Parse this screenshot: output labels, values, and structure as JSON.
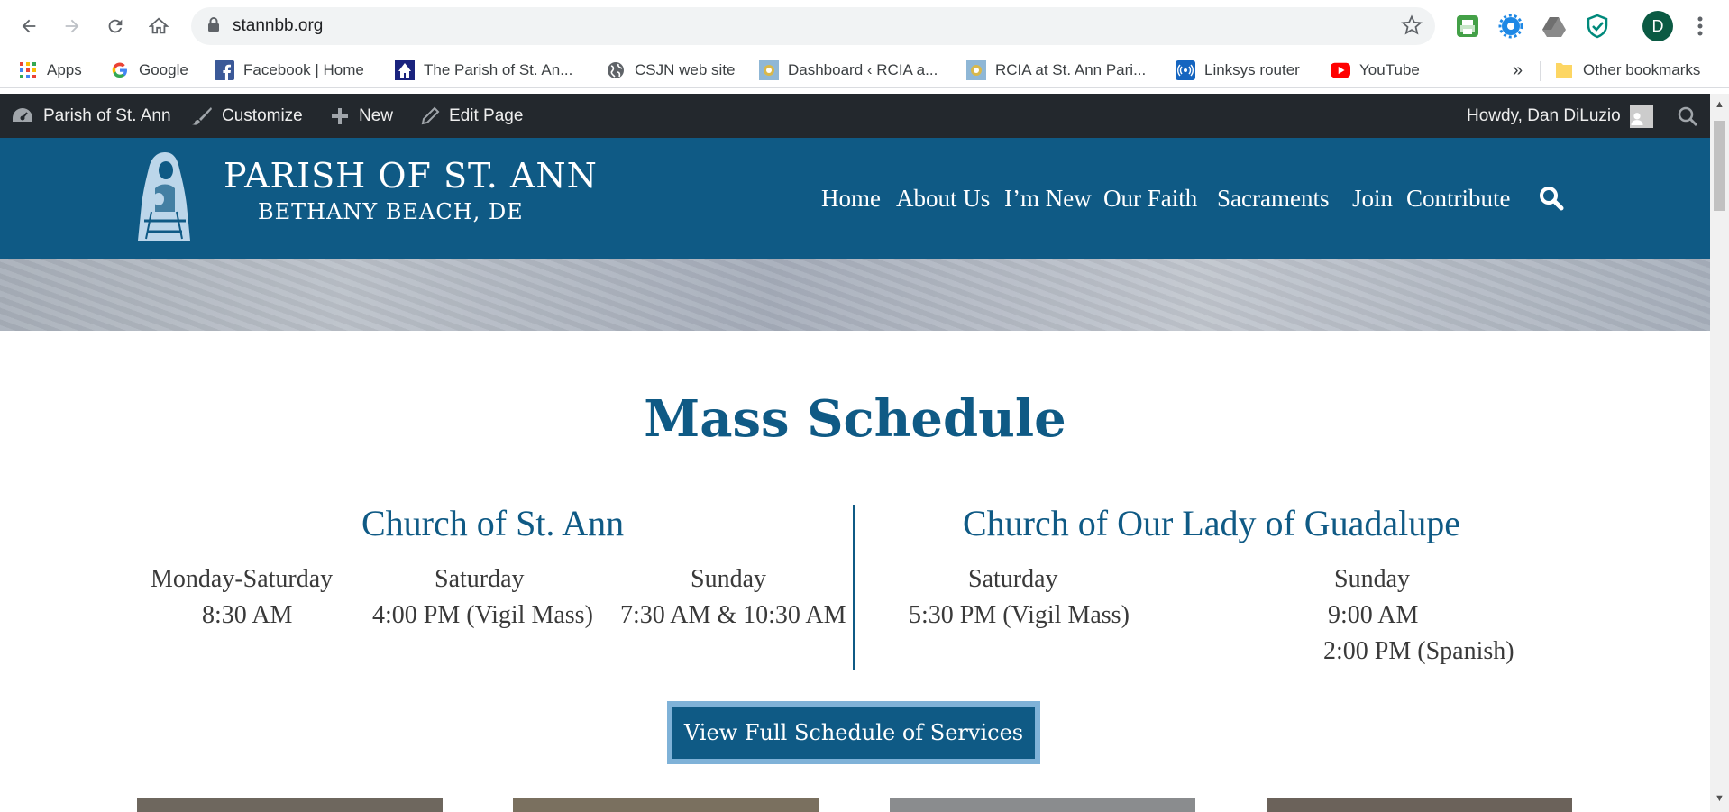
{
  "browser": {
    "url": "stannbb.org",
    "profile_initial": "D"
  },
  "bookmarks": [
    {
      "label": "Apps",
      "icon": "apps-grid-icon"
    },
    {
      "label": "Google",
      "icon": "google-icon"
    },
    {
      "label": "Facebook | Home",
      "icon": "facebook-icon"
    },
    {
      "label": "The Parish of St. An...",
      "icon": "parish-favicon"
    },
    {
      "label": "CSJN web site",
      "icon": "globe-icon"
    },
    {
      "label": "Dashboard ‹ RCIA a...",
      "icon": "rcia-favicon"
    },
    {
      "label": "RCIA at St. Ann Pari...",
      "icon": "rcia-favicon"
    },
    {
      "label": "Linksys router",
      "icon": "linksys-icon"
    },
    {
      "label": "YouTube",
      "icon": "youtube-icon"
    }
  ],
  "bookmarks_overflow": "»",
  "other_bookmarks": "Other bookmarks",
  "admin_bar": {
    "site_name": "Parish of St. Ann",
    "customize": "Customize",
    "new": "New",
    "edit_page": "Edit Page",
    "howdy": "Howdy, Dan DiLuzio"
  },
  "site": {
    "title": "PARISH OF ST. ANN",
    "subtitle": "BETHANY BEACH, DE",
    "nav": [
      "Home",
      "About Us",
      "I’m New",
      "Our Faith",
      "Sacraments",
      "Join",
      "Contribute"
    ]
  },
  "page": {
    "title": "Mass Schedule",
    "churches": [
      {
        "name": "Church of St. Ann",
        "columns": [
          {
            "day": "Monday-Saturday",
            "times": [
              "8:30 AM"
            ]
          },
          {
            "day": "Saturday",
            "times": [
              "4:00 PM (Vigil Mass)"
            ]
          },
          {
            "day": "Sunday",
            "times": [
              "7:30 AM & 10:30 AM"
            ]
          }
        ]
      },
      {
        "name": "Church of Our Lady of Guadalupe",
        "columns": [
          {
            "day": "Saturday",
            "times": [
              "5:30 PM (Vigil Mass)"
            ]
          },
          {
            "day": "Sunday",
            "times": [
              "9:00 AM",
              "2:00 PM (Spanish)"
            ]
          }
        ]
      }
    ],
    "button": "View Full Schedule of Services"
  },
  "colors": {
    "brand_blue": "#0f5a85",
    "admin_bar": "#23282d",
    "button_border": "#7fb2d8"
  }
}
